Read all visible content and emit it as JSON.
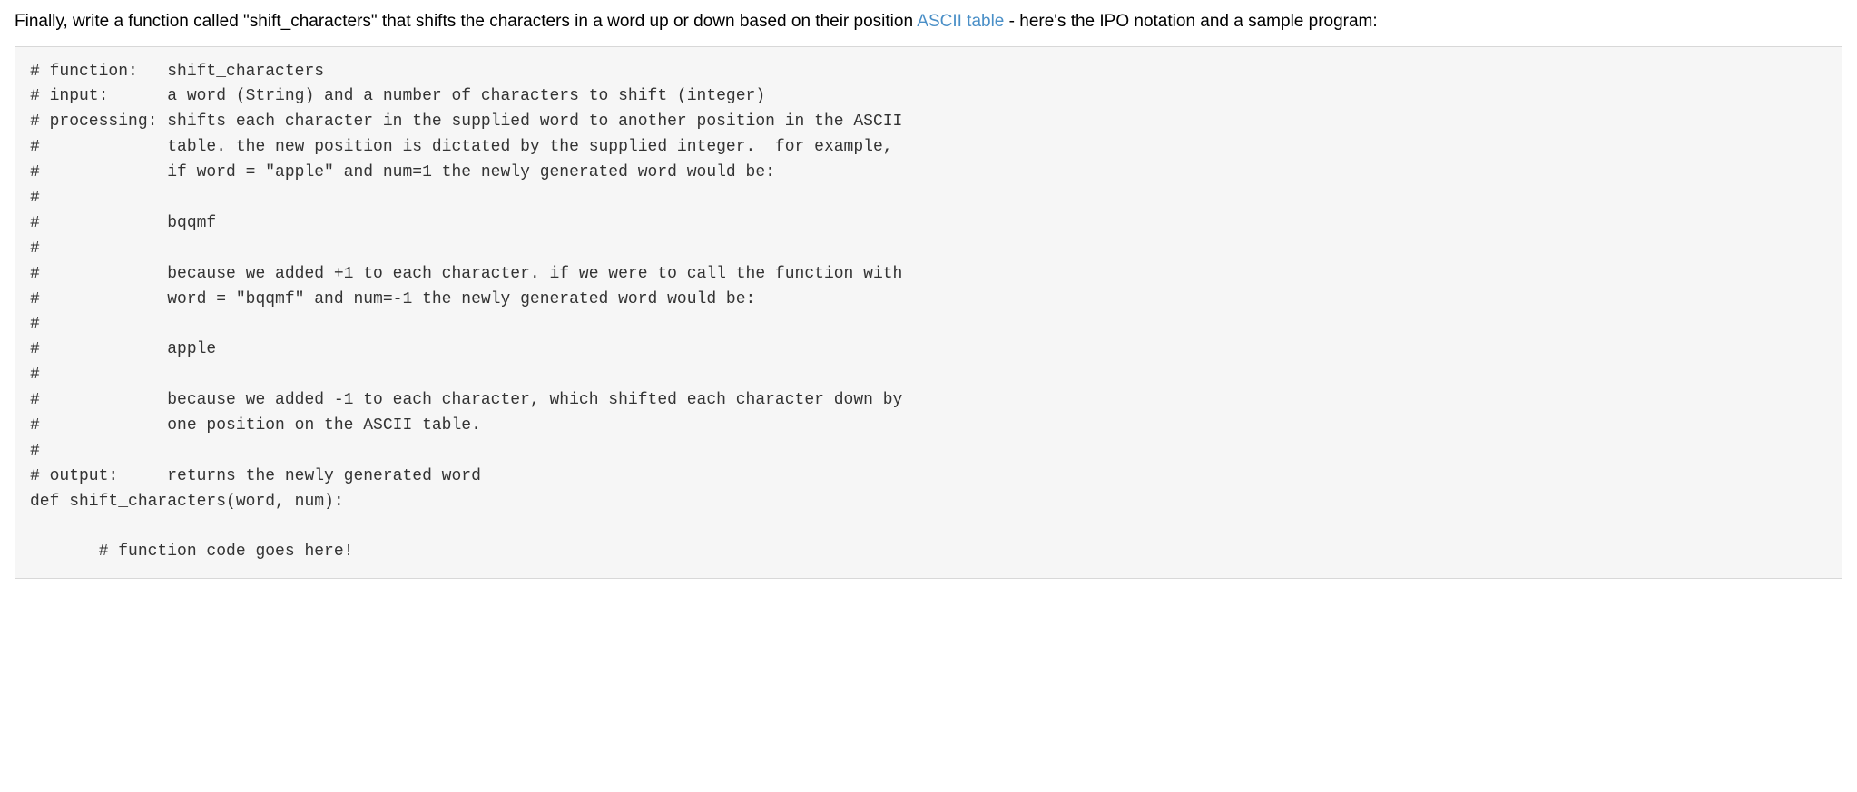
{
  "intro": {
    "before_link": "Finally, write a function called \"shift_characters\" that shifts the characters in a word up or down based on their position ",
    "link_text": "ASCII table",
    "after_link": " - here's the IPO notation and a sample program:"
  },
  "code": "# function:   shift_characters\n# input:      a word (String) and a number of characters to shift (integer)\n# processing: shifts each character in the supplied word to another position in the ASCII\n#             table. the new position is dictated by the supplied integer.  for example,\n#             if word = \"apple\" and num=1 the newly generated word would be:\n#\n#             bqqmf\n#\n#             because we added +1 to each character. if we were to call the function with\n#             word = \"bqqmf\" and num=-1 the newly generated word would be:\n#\n#             apple\n#\n#             because we added -1 to each character, which shifted each character down by\n#             one position on the ASCII table.\n#\n# output:     returns the newly generated word\ndef shift_characters(word, num):\n\n       # function code goes here!"
}
